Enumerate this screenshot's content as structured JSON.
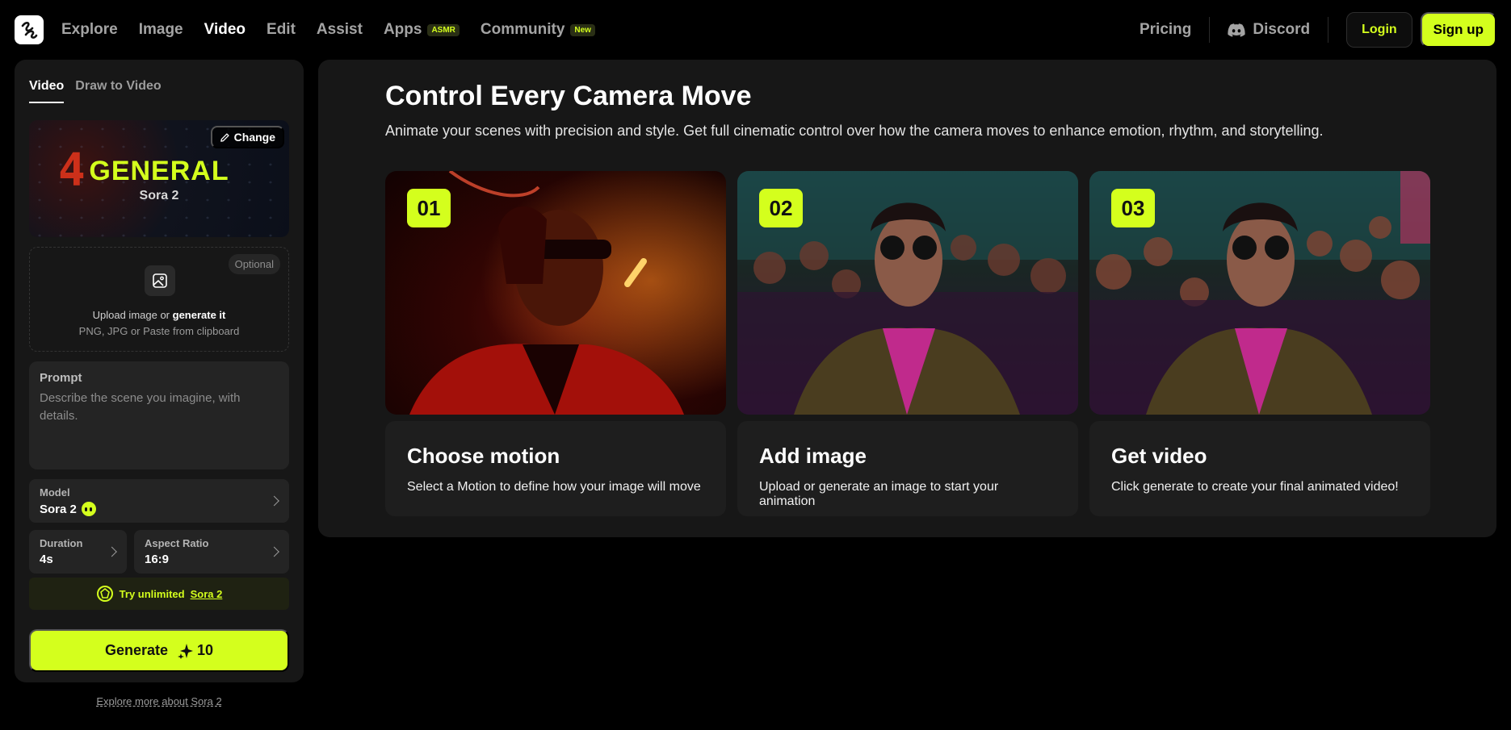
{
  "nav": {
    "items": [
      {
        "label": "Explore",
        "active": false,
        "badge": ""
      },
      {
        "label": "Image",
        "active": false,
        "badge": ""
      },
      {
        "label": "Video",
        "active": true,
        "badge": ""
      },
      {
        "label": "Edit",
        "active": false,
        "badge": ""
      },
      {
        "label": "Assist",
        "active": false,
        "badge": ""
      },
      {
        "label": "Apps",
        "active": false,
        "badge": "ASMR"
      },
      {
        "label": "Community",
        "active": false,
        "badge": "New"
      }
    ],
    "pricing": "Pricing",
    "discord": "Discord",
    "login": "Login",
    "signup": "Sign up"
  },
  "sidebar": {
    "tabs": [
      {
        "label": "Video",
        "active": true
      },
      {
        "label": "Draw to Video",
        "active": false
      }
    ],
    "model_card": {
      "decor_number": "4",
      "title": "GENERAL",
      "subtitle": "Sora 2",
      "change_label": "Change"
    },
    "upload": {
      "optional": "Optional",
      "line1_prefix": "Upload image or ",
      "line1_link": "generate it",
      "line2": "PNG, JPG or Paste from clipboard"
    },
    "prompt": {
      "label": "Prompt",
      "placeholder": "Describe the scene you imagine, with details."
    },
    "model": {
      "label": "Model",
      "value": "Sora 2"
    },
    "duration": {
      "label": "Duration",
      "value": "4s"
    },
    "aspect_ratio": {
      "label": "Aspect Ratio",
      "value": "16:9"
    },
    "try_unlimited": {
      "prefix": "Try unlimited",
      "link": "Sora 2"
    },
    "generate": {
      "label": "Generate",
      "credits": "10"
    },
    "explore_more": "Explore more about Sora 2"
  },
  "main": {
    "title": "Control Every Camera Move",
    "subtitle": "Animate your scenes with precision and style. Get full cinematic control over how the camera moves to enhance emotion, rhythm, and storytelling.",
    "steps": [
      {
        "num": "01",
        "title": "Choose motion",
        "desc": "Select a Motion to define how your image will move"
      },
      {
        "num": "02",
        "title": "Add image",
        "desc": "Upload or generate an image to start your animation"
      },
      {
        "num": "03",
        "title": "Get video",
        "desc": "Click generate to create your final animated video!"
      }
    ]
  },
  "colors": {
    "accent": "#d4ff1d",
    "panel": "#171717",
    "background": "#000000"
  },
  "icons": [
    "logo-icon",
    "discord-icon",
    "pencil-icon",
    "image-upload-icon",
    "chevron-right-icon",
    "sora-icon",
    "sparkle-icon"
  ]
}
